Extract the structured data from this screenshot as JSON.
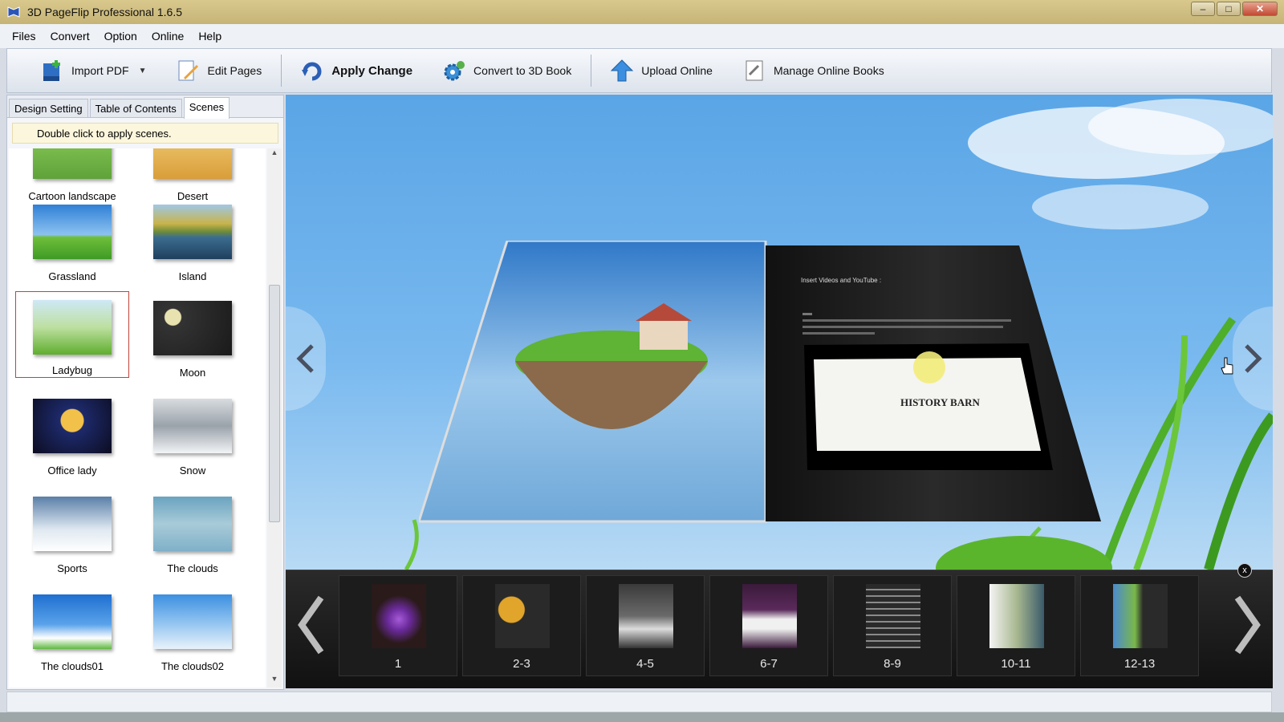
{
  "window": {
    "title": "3D PageFlip Professional 1.6.5"
  },
  "menu": [
    "Files",
    "Convert",
    "Option",
    "Online",
    "Help"
  ],
  "toolbar": {
    "import_pdf": "Import PDF",
    "edit_pages": "Edit Pages",
    "apply_change": "Apply Change",
    "convert_3d": "Convert to 3D Book",
    "upload_online": "Upload Online",
    "manage_online": "Manage Online Books"
  },
  "left_panel": {
    "tabs": [
      "Design Setting",
      "Table of Contents",
      "Scenes"
    ],
    "active_tab": "Scenes",
    "hint": "Double click to apply scenes.",
    "scenes": [
      {
        "label": "Cartoon landscape"
      },
      {
        "label": "Desert"
      },
      {
        "label": "Grassland"
      },
      {
        "label": "Island"
      },
      {
        "label": "Ladybug",
        "selected": true
      },
      {
        "label": "Moon"
      },
      {
        "label": "Office lady"
      },
      {
        "label": "Snow"
      },
      {
        "label": "Sports"
      },
      {
        "label": "The clouds"
      },
      {
        "label": "The clouds01"
      },
      {
        "label": "The clouds02"
      }
    ]
  },
  "book": {
    "right_heading": "Insert Videos and YouTube :",
    "video_title": "HISTORY BARN"
  },
  "thumbnails": [
    "1",
    "2-3",
    "4-5",
    "6-7",
    "8-9",
    "10-11",
    "12-13"
  ],
  "strip_close": "x"
}
